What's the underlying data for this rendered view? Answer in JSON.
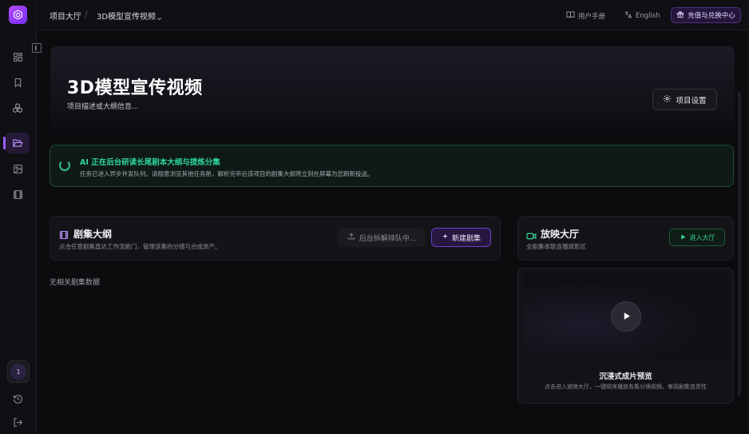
{
  "app": {
    "logo": "cube-logo-icon"
  },
  "sidebar": {
    "items": [
      {
        "icon": "dashboard-icon"
      },
      {
        "icon": "bookmark-icon"
      },
      {
        "icon": "assets-icon"
      },
      {
        "icon": "folder-icon",
        "active": true
      },
      {
        "icon": "image-icon"
      },
      {
        "icon": "film-icon"
      }
    ],
    "avatar_label": "1",
    "bottom": [
      {
        "icon": "history-icon"
      },
      {
        "icon": "logout-icon"
      }
    ]
  },
  "header": {
    "breadcrumb_root": "项目大厅",
    "breadcrumb_sep": "/",
    "breadcrumb_current": "3D模型宣传视频",
    "manual": "用户手册",
    "language": "English",
    "recharge": "充值与兑换中心"
  },
  "project": {
    "title": "3D模型宣传视频",
    "description": "项目描述或大纲信息...",
    "settings_label": "项目设置"
  },
  "ai_status": {
    "title": "AI 正在后台研读长尾剧本大纲与提炼分集",
    "subtitle": "任务已进入异步并发队列。请随意浏览其他任务舱，解析完毕后该项目的剧集大纲将立刻在屏幕为您刷新投送。"
  },
  "episodes": {
    "title": "剧集大纲",
    "subtitle": "点击任意剧集直达工作流舱门，管理该集的分镜与合成资产。",
    "queue_label": "后台拆解排队中...",
    "new_label": "新建剧集",
    "empty": "无相关剧集数据"
  },
  "screening": {
    "title": "放映大厅",
    "subtitle": "全剧集串联连播观影区",
    "enter_label": "进入大厅",
    "preview_title": "沉浸式成片预览",
    "preview_subtitle": "点击进入放映大厅，一键顺序播放各集分镜视频，审阅剧集连贯性"
  },
  "colors": {
    "accent": "#9b5cff",
    "success": "#2fd49a",
    "background": "#0c0c0f"
  }
}
